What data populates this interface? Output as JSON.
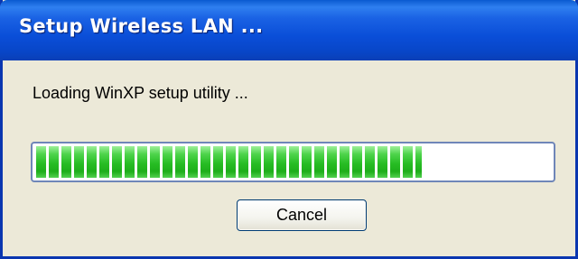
{
  "window": {
    "title": "Setup Wireless LAN ..."
  },
  "message": {
    "text": "Loading WinXP setup utility ..."
  },
  "progress": {
    "fraction": 0.75,
    "color": "#27bd24"
  },
  "buttons": {
    "cancel_label": "Cancel"
  },
  "colors": {
    "titlebar": "#0a4ed8",
    "dialog_bg": "#ece9d8",
    "button_border": "#003c74"
  }
}
